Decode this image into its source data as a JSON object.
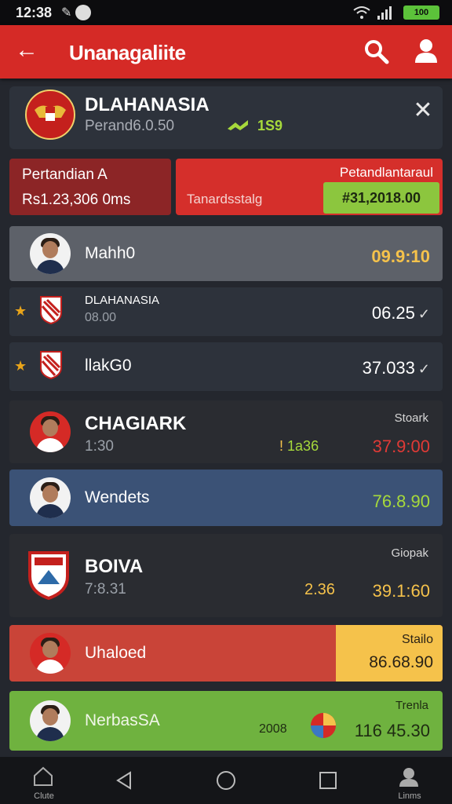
{
  "status_bar": {
    "time": "12:38",
    "battery": "100"
  },
  "app_bar": {
    "title": "Unanagaliite"
  },
  "match": {
    "name": "DLAHANASIA",
    "sub": "Perand6.0.50",
    "trend": "1S9"
  },
  "summary": {
    "left_line1": "Pertandian A",
    "left_line2": "Rs1.23,306 0ms",
    "right_line1": "Petandlantaraul",
    "right_line2": "Tanardsstalg",
    "amount": "#31,2018.00"
  },
  "rows": [
    {
      "name": "Mahh0",
      "label": "",
      "value": "09.9:10"
    },
    {
      "name": "DLAHANASIA",
      "sub": "08.00",
      "value": "06.25"
    },
    {
      "name": "llakG0",
      "value": "37.033"
    },
    {
      "name": "CHAGIARK",
      "sub": "1:30",
      "label": "Stoark",
      "extra": "1a36",
      "value": "37.9:00"
    },
    {
      "name": "Wendets",
      "value": "76.8.90"
    },
    {
      "name": "BOIVA",
      "sub": "7:8.31",
      "label": "Giopak",
      "extra": "2.36",
      "value": "39.1:60"
    },
    {
      "name": "Uhaloed",
      "label": "Stailo",
      "value": "86.68.90"
    },
    {
      "name": "NerbasSA",
      "label": "Trenla",
      "extra": "2008",
      "value": "116 45.30"
    }
  ],
  "nav": {
    "left_label": "Clute",
    "right_label": "Linms"
  },
  "colors": {
    "accent": "#d52a26",
    "green": "#8cc63e",
    "yellow": "#f5c24b",
    "row_blue": "#3b5276"
  }
}
